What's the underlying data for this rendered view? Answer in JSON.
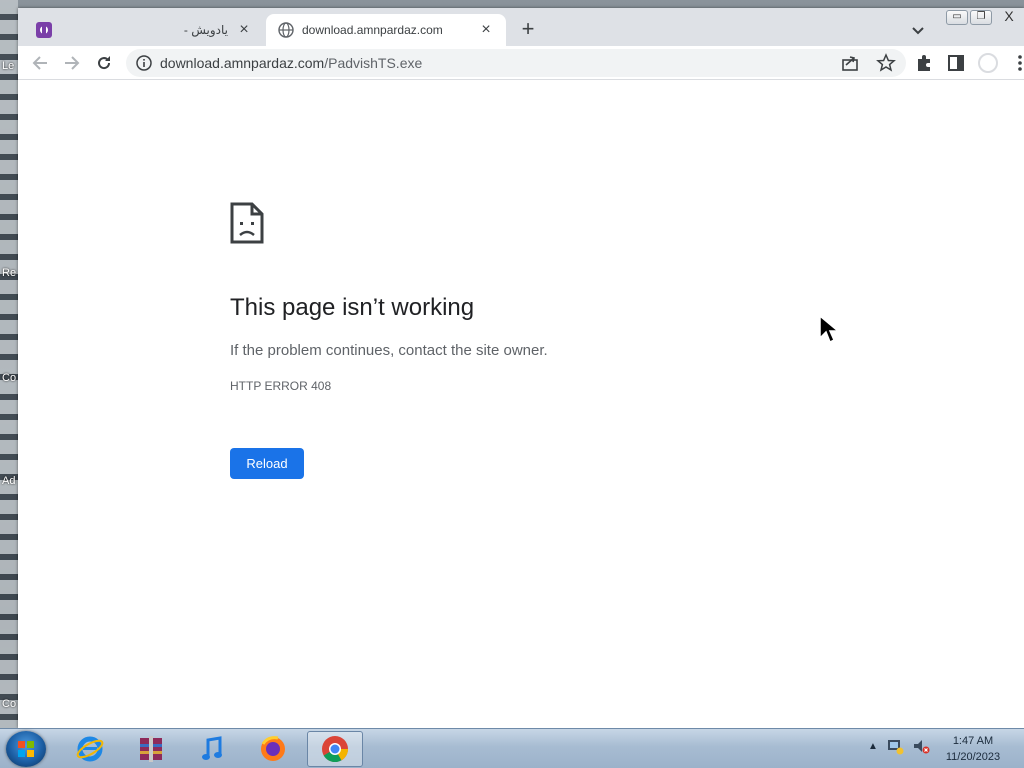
{
  "desktop": {
    "labels": [
      "Le",
      "Re",
      "Co",
      "Ad",
      "Co"
    ]
  },
  "browser": {
    "tabs": [
      {
        "title": "یادویش -",
        "close": "×",
        "active": false
      },
      {
        "title": "download.amnpardaz.com",
        "close": "×",
        "active": true
      }
    ],
    "new_tab": "+",
    "toolbar": {
      "url_host": "download.amnpardaz.com",
      "url_path": "/PadvishTS.exe"
    },
    "window_controls": {
      "close": "X"
    }
  },
  "error_page": {
    "title": "This page isn’t working",
    "description": "If the problem continues, contact the site owner.",
    "code": "HTTP ERROR 408",
    "reload_label": "Reload"
  },
  "taskbar": {
    "apps": [
      "internet-explorer",
      "winrar",
      "itunes",
      "firefox",
      "chrome"
    ],
    "clock": {
      "time": "1:47 AM",
      "date": "11/20/2023"
    }
  },
  "colors": {
    "accent": "#1a73e8",
    "tabstrip": "#dee1e6"
  }
}
